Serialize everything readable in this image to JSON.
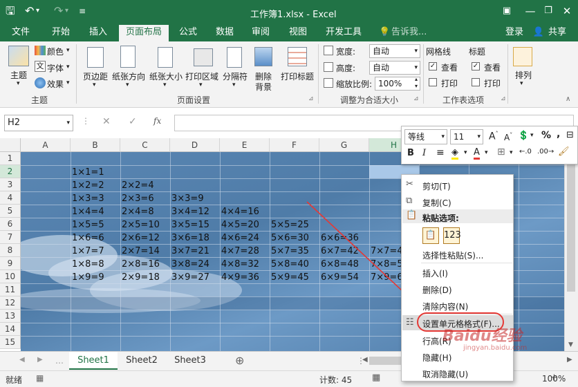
{
  "title": {
    "text": "工作簿1.xlsx - Excel"
  },
  "menu": [
    {
      "label": "文件"
    },
    {
      "label": "开始"
    },
    {
      "label": "插入"
    },
    {
      "label": "页面布局"
    },
    {
      "label": "公式"
    },
    {
      "label": "数据"
    },
    {
      "label": "审阅"
    },
    {
      "label": "视图"
    },
    {
      "label": "开发工具"
    },
    {
      "label": "告诉我..."
    },
    {
      "label": "登录"
    },
    {
      "label": "共享"
    }
  ],
  "ribbon": {
    "theme": {
      "big": "主题",
      "colors": "颜色",
      "fonts": "字体",
      "effects": "效果",
      "group": "主题"
    },
    "page": {
      "margin": "页边距",
      "orient": "纸张方向",
      "size": "纸张大小",
      "area": "打印区域",
      "breaks": "分隔符",
      "bg1": "删除",
      "bg2": "背景",
      "titles": "打印标题",
      "group": "页面设置"
    },
    "scale": {
      "width_label": "宽度:",
      "width_val": "自动",
      "height_label": "高度:",
      "height_val": "自动",
      "zoom_label": "缩放比例:",
      "zoom_val": "100%",
      "group": "调整为合适大小"
    },
    "opts": {
      "grid": "网格线",
      "head": "标题",
      "view1": "查看",
      "view2": "查看",
      "print1": "打印",
      "print2": "打印",
      "group": "工作表选项"
    },
    "arrange": {
      "label": "排列"
    }
  },
  "formula": {
    "namebox": "H2",
    "fx": "fx"
  },
  "columns": [
    "A",
    "B",
    "C",
    "D",
    "E",
    "F",
    "G",
    "H"
  ],
  "rows": [
    "1",
    "2",
    "3",
    "4",
    "5",
    "6",
    "7",
    "8",
    "9",
    "10",
    "11",
    "12",
    "13",
    "14",
    "15"
  ],
  "cells": {
    "r2": [
      "1×1=1"
    ],
    "r3": [
      "1×2=2",
      "2×2=4"
    ],
    "r4": [
      "1×3=3",
      "2×3=6",
      "3×3=9"
    ],
    "r5": [
      "1×4=4",
      "2×4=8",
      "3×4=12",
      "4×4=16"
    ],
    "r6": [
      "1×5=5",
      "2×5=10",
      "3×5=15",
      "4×5=20",
      "5×5=25"
    ],
    "r7": [
      "1×6=6",
      "2×6=12",
      "3×6=18",
      "4×6=24",
      "5×6=30",
      "6×6=36"
    ],
    "r8": [
      "1×7=7",
      "2×7=14",
      "3×7=21",
      "4×7=28",
      "5×7=35",
      "6×7=42",
      "7×7=4"
    ],
    "r9": [
      "1×8=8",
      "2×8=16",
      "3×8=24",
      "4×8=32",
      "5×8=40",
      "6×8=48",
      "7×8=5"
    ],
    "r10": [
      "1×9=9",
      "2×9=18",
      "3×9=27",
      "4×9=36",
      "5×9=45",
      "6×9=54",
      "7×9=6"
    ]
  },
  "mini": {
    "font": "等线",
    "size": "11"
  },
  "context": {
    "cut": "剪切(T)",
    "copy": "复制(C)",
    "paste_header": "粘贴选项:",
    "paste_special": "选择性粘贴(S)...",
    "insert": "插入(I)",
    "delete": "删除(D)",
    "clear": "清除内容(N)",
    "format": "设置单元格格式(F)...",
    "rowheight": "行高(R)",
    "hide": "隐藏(H)",
    "unhide": "取消隐藏(U)"
  },
  "sheets": [
    "Sheet1",
    "Sheet2",
    "Sheet3"
  ],
  "status": {
    "ready": "就绪",
    "count": "计数: 45",
    "zoom": "100%"
  },
  "watermark": {
    "brand": "Baidu经验",
    "url": "jingyan.baidu.com"
  },
  "colors": {
    "accent": "#217346",
    "annotation": "#e53935"
  }
}
